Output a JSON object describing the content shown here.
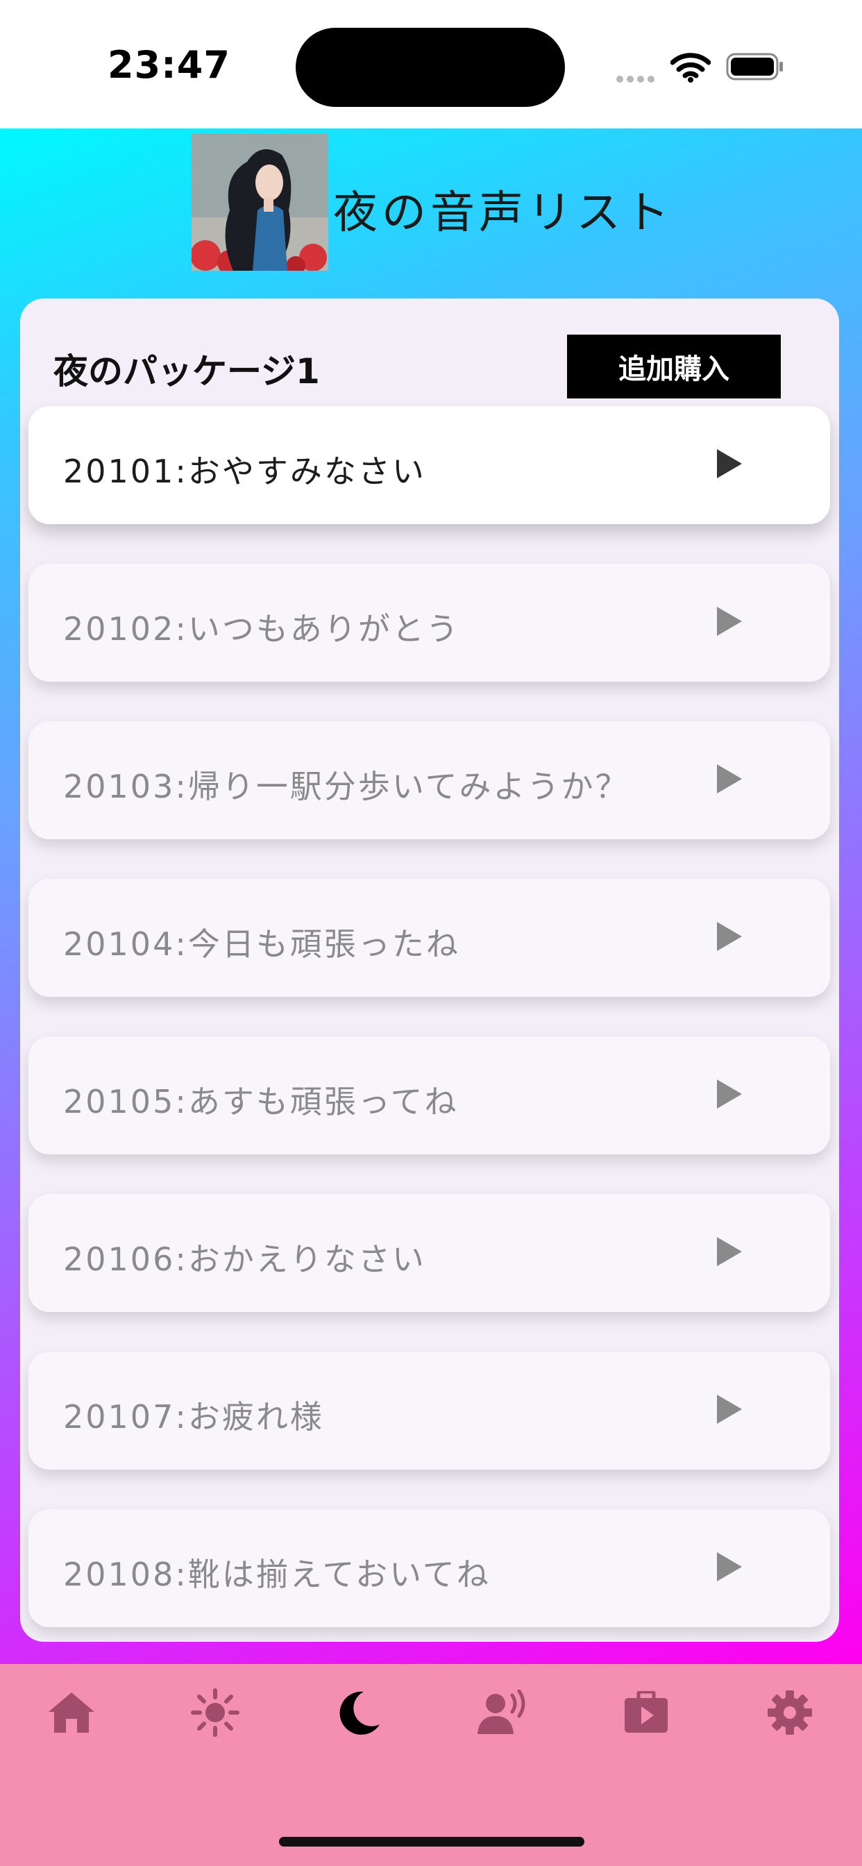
{
  "status_bar": {
    "time": "23:47"
  },
  "header": {
    "title": "夜の音声リスト",
    "avatar": "woman-illustration-avatar"
  },
  "package": {
    "title": "夜のパッケージ1",
    "buy_label": "追加購入"
  },
  "tracks": [
    {
      "label": "20101:おやすみなさい",
      "active": true
    },
    {
      "label": "20102:いつもありがとう",
      "active": false
    },
    {
      "label": "20103:帰り一駅分歩いてみようか？",
      "active": false
    },
    {
      "label": "20104:今日も頑張ったね",
      "active": false
    },
    {
      "label": "20105:あすも頑張ってね",
      "active": false
    },
    {
      "label": "20106:おかえりなさい",
      "active": false
    },
    {
      "label": "20107:お疲れ様",
      "active": false
    },
    {
      "label": "20108:靴は揃えておいてね",
      "active": false
    }
  ],
  "tab_bar": {
    "items": [
      {
        "icon": "home-icon",
        "active": false
      },
      {
        "icon": "sun-icon",
        "active": false
      },
      {
        "icon": "moon-icon",
        "active": true
      },
      {
        "icon": "speaking-person-icon",
        "active": false
      },
      {
        "icon": "video-case-icon",
        "active": false
      },
      {
        "icon": "gear-icon",
        "active": false
      }
    ]
  },
  "colors": {
    "gradient_top": "#00f8ff",
    "gradient_bottom": "#ff00f0",
    "tab_bar": "#f48fb1",
    "tab_icon": "#a24c6c",
    "tab_icon_active": "#000000"
  }
}
